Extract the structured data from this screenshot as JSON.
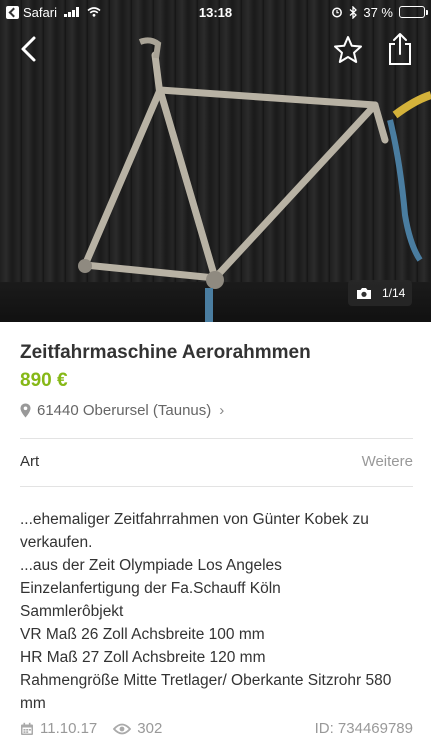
{
  "status_bar": {
    "app": "Safari",
    "time": "13:18",
    "battery": "37 %",
    "battery_level": 0.37
  },
  "photo": {
    "counter": "1/14"
  },
  "listing": {
    "title": "Zeitfahrmaschine  Aerorahmmen",
    "price": "890 €",
    "location": "61440 Oberursel (Taunus)",
    "attribute_label": "Art",
    "attribute_value": "Weitere",
    "description": [
      "...ehemaliger Zeitfahrrahmen von Günter Kobek zu verkaufen.",
      "...aus der Zeit Olympiade Los Angeles",
      "Einzelanfertigung der Fa.Schauff Köln",
      "Sammlerôbjekt",
      "VR Maß 26 Zoll Achsbreite 100 mm",
      "HR Maß 27 Zoll Achsbreite 120 mm",
      "Rahmengröße Mitte Tretlager/ Oberkante Sitzrohr 580 mm"
    ],
    "date": "11.10.17",
    "views": "302",
    "id": "ID: 734469789"
  },
  "colors": {
    "price": "#86b817",
    "battery": "#ffcc00"
  },
  "icons": [
    "back-arrow-icon",
    "star-icon",
    "share-icon",
    "camera-icon",
    "location-pin-icon",
    "calendar-icon",
    "eye-icon"
  ]
}
